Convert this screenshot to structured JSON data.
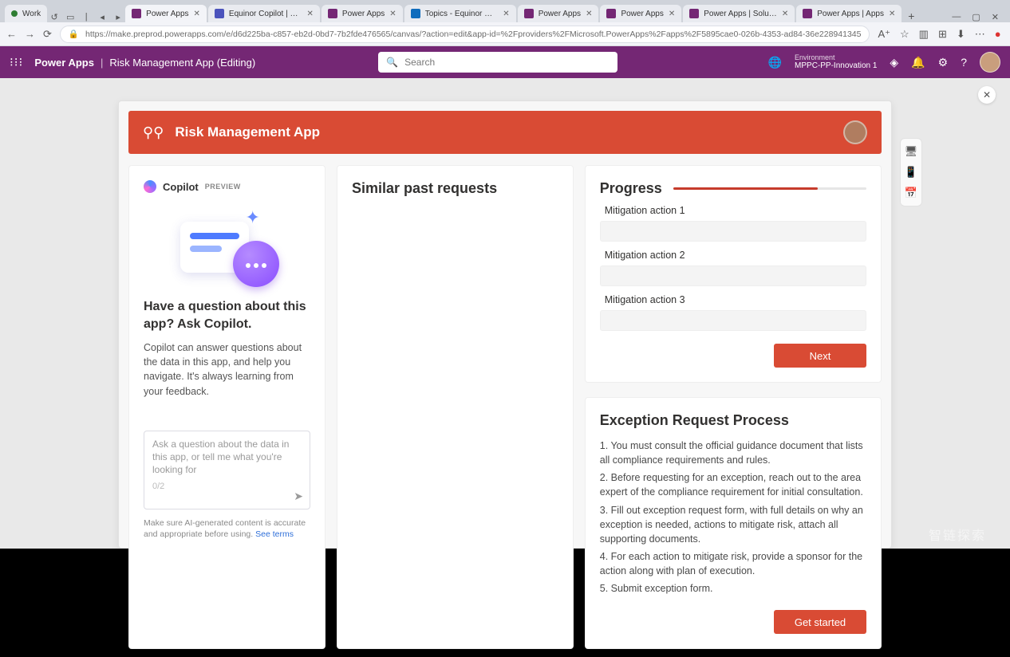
{
  "browser": {
    "workspace_label": "Work",
    "tabs": [
      {
        "label": "Power Apps",
        "favicon": "#742774",
        "active": true
      },
      {
        "label": "Equinor Copilot | Microsoft Tea…",
        "favicon": "#4b53bc",
        "active": false
      },
      {
        "label": "Power Apps",
        "favicon": "#742774",
        "active": false
      },
      {
        "label": "Topics - Equinor Copilot | Powe…",
        "favicon": "#0f6cbd",
        "active": false
      },
      {
        "label": "Power Apps",
        "favicon": "#742774",
        "active": false
      },
      {
        "label": "Power Apps",
        "favicon": "#742774",
        "active": false
      },
      {
        "label": "Power Apps | Solutions - Equin…",
        "favicon": "#742774",
        "active": false
      },
      {
        "label": "Power Apps | Apps",
        "favicon": "#742774",
        "active": false
      }
    ],
    "url": "https://make.preprod.powerapps.com/e/d6d225ba-c857-eb2d-0bd7-7b2fde476565/canvas/?action=edit&app-id=%2Fproviders%2FMicrosoft.PowerApps%2Fapps%2F5895cae0-026b-4353-ad84-36e228941345"
  },
  "power_apps": {
    "product": "Power Apps",
    "breadcrumb": "Risk Management App (Editing)",
    "search_placeholder": "Search",
    "env_label": "Environment",
    "env_name": "MPPC-PP-Innovation 1"
  },
  "app_banner": {
    "title": "Risk Management App"
  },
  "copilot": {
    "name": "Copilot",
    "badge": "PREVIEW",
    "heading": "Have a question about this app? Ask Copilot.",
    "body": "Copilot can answer questions about the data in this app, and help you navigate. It's always learning from your feedback.",
    "placeholder": "Ask a question about the data in this app, or tell me what you're looking for",
    "input_hint": "0/2",
    "footer_pre": "Make sure AI-generated content is accurate and appropriate before using. ",
    "footer_link": "See terms"
  },
  "middle": {
    "heading": "Similar past requests"
  },
  "progress": {
    "heading": "Progress",
    "percent": 75,
    "actions": [
      "Mitigation action 1",
      "Mitigation action 2",
      "Mitigation action 3"
    ],
    "next_label": "Next"
  },
  "exception": {
    "heading": "Exception Request Process",
    "steps": [
      "1. You must consult the official guidance document that lists all compliance requirements and rules.",
      "2. Before requesting for an exception, reach out to the area expert of the compliance requirement for initial consultation.",
      "3. Fill out exception request form, with full details on why an exception is needed, actions to mitigate risk, attach all supporting documents.",
      "4. For each action to mitigate risk, provide a sponsor for the action along with plan of execution.",
      "5. Submit exception form."
    ],
    "cta": "Get started"
  },
  "watermark": "智链探索"
}
